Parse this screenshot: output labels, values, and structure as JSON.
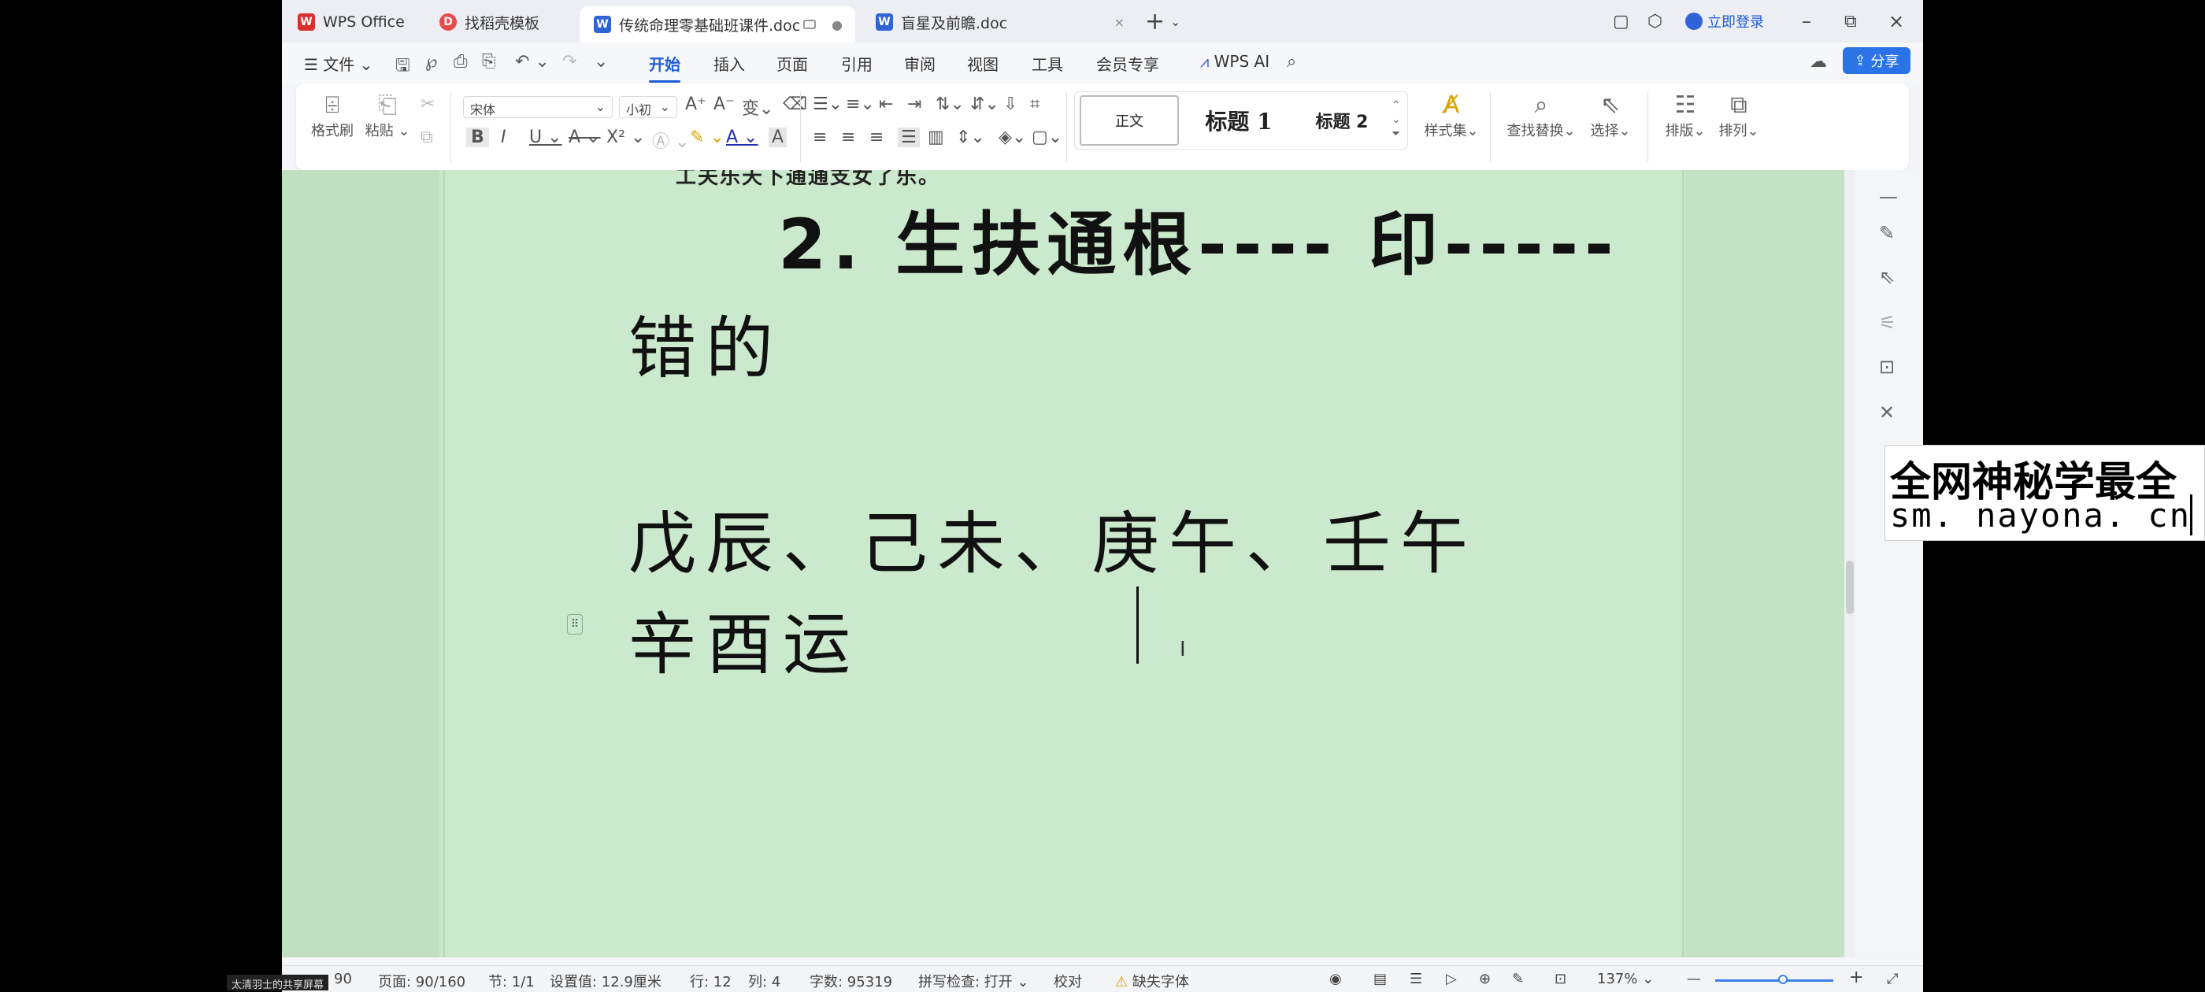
{
  "tabs": [
    {
      "label": "WPS Office",
      "icon": "wps-logo-icon",
      "color": "#d9302d"
    },
    {
      "label": "找稻壳模板",
      "icon": "docer-icon",
      "color": "#e84a4a"
    },
    {
      "label": "传统命理零基础班课件.doc",
      "icon": "word-doc-icon",
      "color": "#2f63d6",
      "active": true
    },
    {
      "label": "盲星及前瞻.doc",
      "icon": "word-doc-icon",
      "color": "#2f63d6"
    }
  ],
  "titlebar": {
    "login_label": "立即登录"
  },
  "menu": {
    "file_label": "文件",
    "items": [
      "开始",
      "插入",
      "页面",
      "引用",
      "审阅",
      "视图",
      "工具",
      "会员专享"
    ],
    "active": "开始",
    "wps_ai_label": "WPS AI",
    "share_label": "分享"
  },
  "ribbon": {
    "format_painter": "格式刷",
    "paste": "粘贴",
    "font_name": "宋体",
    "font_size": "小初",
    "styles": [
      "正文",
      "标题 1",
      "标题 2"
    ],
    "style_gallery": "样式集",
    "find_replace": "查找替换",
    "select": "选择",
    "layout": "排版",
    "arrange": "排列"
  },
  "document": {
    "cut_line": "工夫乐天下通通支女了乐。",
    "heading_line1": "2. 生扶通根---- 印-----",
    "heading_line2": "错的",
    "body_line1": "戊辰、己未、庚午、壬午",
    "body_line2": "辛酉运"
  },
  "statusbar": {
    "page_num": "90",
    "pages": "页面: 90/160",
    "section": "节: 1/1",
    "setting": "设置值: 12.9厘米",
    "row": "行: 12",
    "col": "列: 4",
    "word_count": "字数: 95319",
    "spell_check": "拼写检查: 打开",
    "proofread": "校对",
    "missing_font": "缺失字体",
    "zoom": "137%"
  },
  "watermark": {
    "line1": "全网神秘学最全",
    "line2": "sm. nayona. cn"
  },
  "sharer_label": "太清羽士的共享屏幕",
  "colors": {
    "accent": "#1f5dd6",
    "doc_bg": "#cbe9cc",
    "share_btn": "#2a74e8"
  }
}
